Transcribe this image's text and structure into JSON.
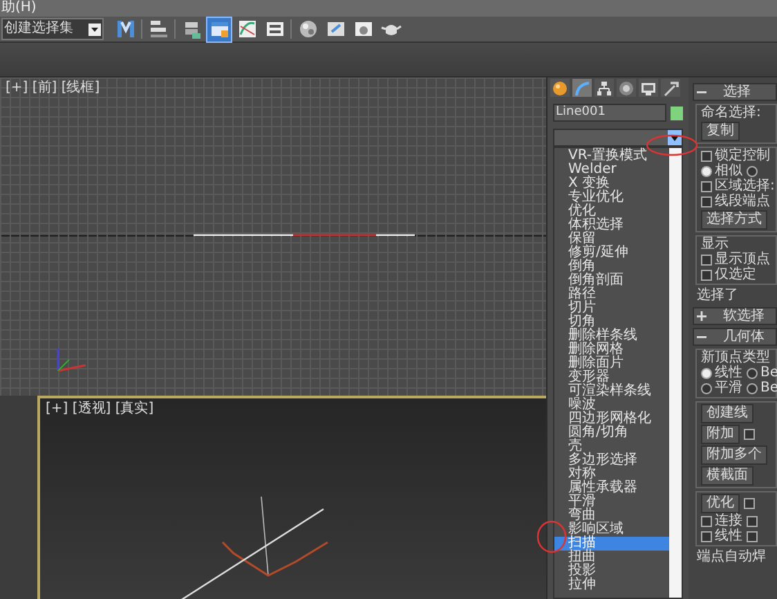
{
  "menu_bar": {
    "label": "助(H)"
  },
  "toolbar": {
    "selection_set": {
      "placeholder": "创建选择集"
    },
    "tools": [
      {
        "kind": "mirror",
        "selected": false
      },
      {
        "kind": "align",
        "selected": false
      },
      {
        "kind": "layers",
        "selected": false
      },
      {
        "kind": "explorer",
        "selected": true
      },
      {
        "kind": "curve",
        "selected": false
      },
      {
        "kind": "schematic",
        "selected": false
      },
      {
        "kind": "material",
        "selected": false
      },
      {
        "kind": "render_setup",
        "selected": false
      },
      {
        "kind": "frame",
        "selected": false
      },
      {
        "kind": "teapot",
        "selected": false
      }
    ]
  },
  "viewports": [
    {
      "kind": "grid",
      "label": "[+] [前] [线框]",
      "active": false
    },
    {
      "kind": "perspective",
      "label": "[+] [透视] [真实]",
      "active": true
    }
  ],
  "command_panel": {
    "tabs": [
      {
        "kind": "create",
        "selected": false
      },
      {
        "kind": "modify",
        "selected": true
      },
      {
        "kind": "hierarchy",
        "selected": false
      },
      {
        "kind": "motion",
        "selected": false
      },
      {
        "kind": "display",
        "selected": false
      },
      {
        "kind": "utilities",
        "selected": false
      }
    ],
    "object_name": "Line001",
    "modifier_list": {
      "expanded": true,
      "items": [
        {
          "label": "VR-置换模式",
          "selected": false
        },
        {
          "label": "Welder",
          "selected": false
        },
        {
          "label": "X 变换",
          "selected": false
        },
        {
          "label": "专业优化",
          "selected": false
        },
        {
          "label": "优化",
          "selected": false
        },
        {
          "label": "体积选择",
          "selected": false
        },
        {
          "label": "保留",
          "selected": false
        },
        {
          "label": "修剪/延伸",
          "selected": false
        },
        {
          "label": "倒角",
          "selected": false
        },
        {
          "label": "倒角剖面",
          "selected": false
        },
        {
          "label": "路径",
          "selected": false
        },
        {
          "label": "切片",
          "selected": false
        },
        {
          "label": "切角",
          "selected": false
        },
        {
          "label": "删除样条线",
          "selected": false
        },
        {
          "label": "删除网格",
          "selected": false
        },
        {
          "label": "删除面片",
          "selected": false
        },
        {
          "label": "变形器",
          "selected": false
        },
        {
          "label": "可渲染样条线",
          "selected": false
        },
        {
          "label": "噪波",
          "selected": false
        },
        {
          "label": "四边形网格化",
          "selected": false
        },
        {
          "label": "圆角/切角",
          "selected": false
        },
        {
          "label": "壳",
          "selected": false
        },
        {
          "label": "多边形选择",
          "selected": false
        },
        {
          "label": "对称",
          "selected": false
        },
        {
          "label": "属性承载器",
          "selected": false
        },
        {
          "label": "平滑",
          "selected": false
        },
        {
          "label": "弯曲",
          "selected": false
        },
        {
          "label": "影响区域",
          "selected": false
        },
        {
          "label": "扫描",
          "selected": true
        },
        {
          "label": "扭曲",
          "selected": false
        },
        {
          "label": "投影",
          "selected": false
        },
        {
          "label": "拉伸",
          "selected": false
        }
      ]
    },
    "rollouts": [
      {
        "title": "选择",
        "expanded": true,
        "groups": [
          {
            "label": "命名选择:",
            "rows": [
              [
                {
                  "kind": "button",
                  "label": "复制"
                }
              ]
            ]
          },
          {
            "rows": [
              [
                {
                  "kind": "checkbox",
                  "label": "锁定控制",
                  "checked": false
                }
              ],
              [
                {
                  "kind": "radio",
                  "label": "相似",
                  "selected": true
                },
                {
                  "kind": "radio",
                  "selected": false
                }
              ],
              [
                {
                  "kind": "checkbox",
                  "label": "区域选择:",
                  "checked": false
                }
              ],
              [
                {
                  "kind": "checkbox",
                  "label": "线段端点",
                  "checked": false
                }
              ],
              [
                {
                  "kind": "button",
                  "label": "选择方式"
                }
              ]
            ]
          },
          {
            "label": "显示",
            "rows": [
              [
                {
                  "kind": "checkbox",
                  "label": "显示顶点",
                  "checked": false
                }
              ],
              [
                {
                  "kind": "checkbox",
                  "label": "仅选定",
                  "checked": false
                }
              ]
            ]
          },
          {
            "rows": [
              [
                {
                  "kind": "text",
                  "label": "选择了"
                }
              ]
            ]
          }
        ]
      },
      {
        "title": "软选择",
        "expanded": false
      },
      {
        "title": "几何体",
        "expanded": true,
        "groups": [
          {
            "label": "新顶点类型",
            "rows": [
              [
                {
                  "kind": "radio",
                  "label": "线性",
                  "selected": true
                },
                {
                  "kind": "radio",
                  "label": "Be",
                  "selected": false
                }
              ],
              [
                {
                  "kind": "radio",
                  "label": "平滑",
                  "selected": false
                },
                {
                  "kind": "radio",
                  "label": "Be",
                  "selected": false
                }
              ]
            ]
          },
          {
            "rows": [
              [
                {
                  "kind": "button",
                  "label": "创建线"
                }
              ],
              [
                {
                  "kind": "button",
                  "label": "附加"
                },
                {
                  "kind": "checkbox",
                  "checked": false
                }
              ],
              [
                {
                  "kind": "button",
                  "label": "附加多个"
                }
              ],
              [
                {
                  "kind": "button",
                  "label": "横截面"
                }
              ]
            ]
          },
          {
            "rows": [
              [
                {
                  "kind": "button",
                  "label": "优化"
                },
                {
                  "kind": "checkbox",
                  "checked": false
                }
              ],
              [
                {
                  "kind": "checkbox",
                  "label": "连接",
                  "checked": false
                },
                {
                  "kind": "checkbox",
                  "checked": false
                }
              ],
              [
                {
                  "kind": "checkbox",
                  "label": "线性",
                  "checked": false
                },
                {
                  "kind": "checkbox",
                  "checked": false
                }
              ]
            ]
          },
          {
            "rows": [
              [
                {
                  "kind": "text",
                  "label": "端点自动焊"
                }
              ]
            ]
          }
        ]
      }
    ]
  }
}
